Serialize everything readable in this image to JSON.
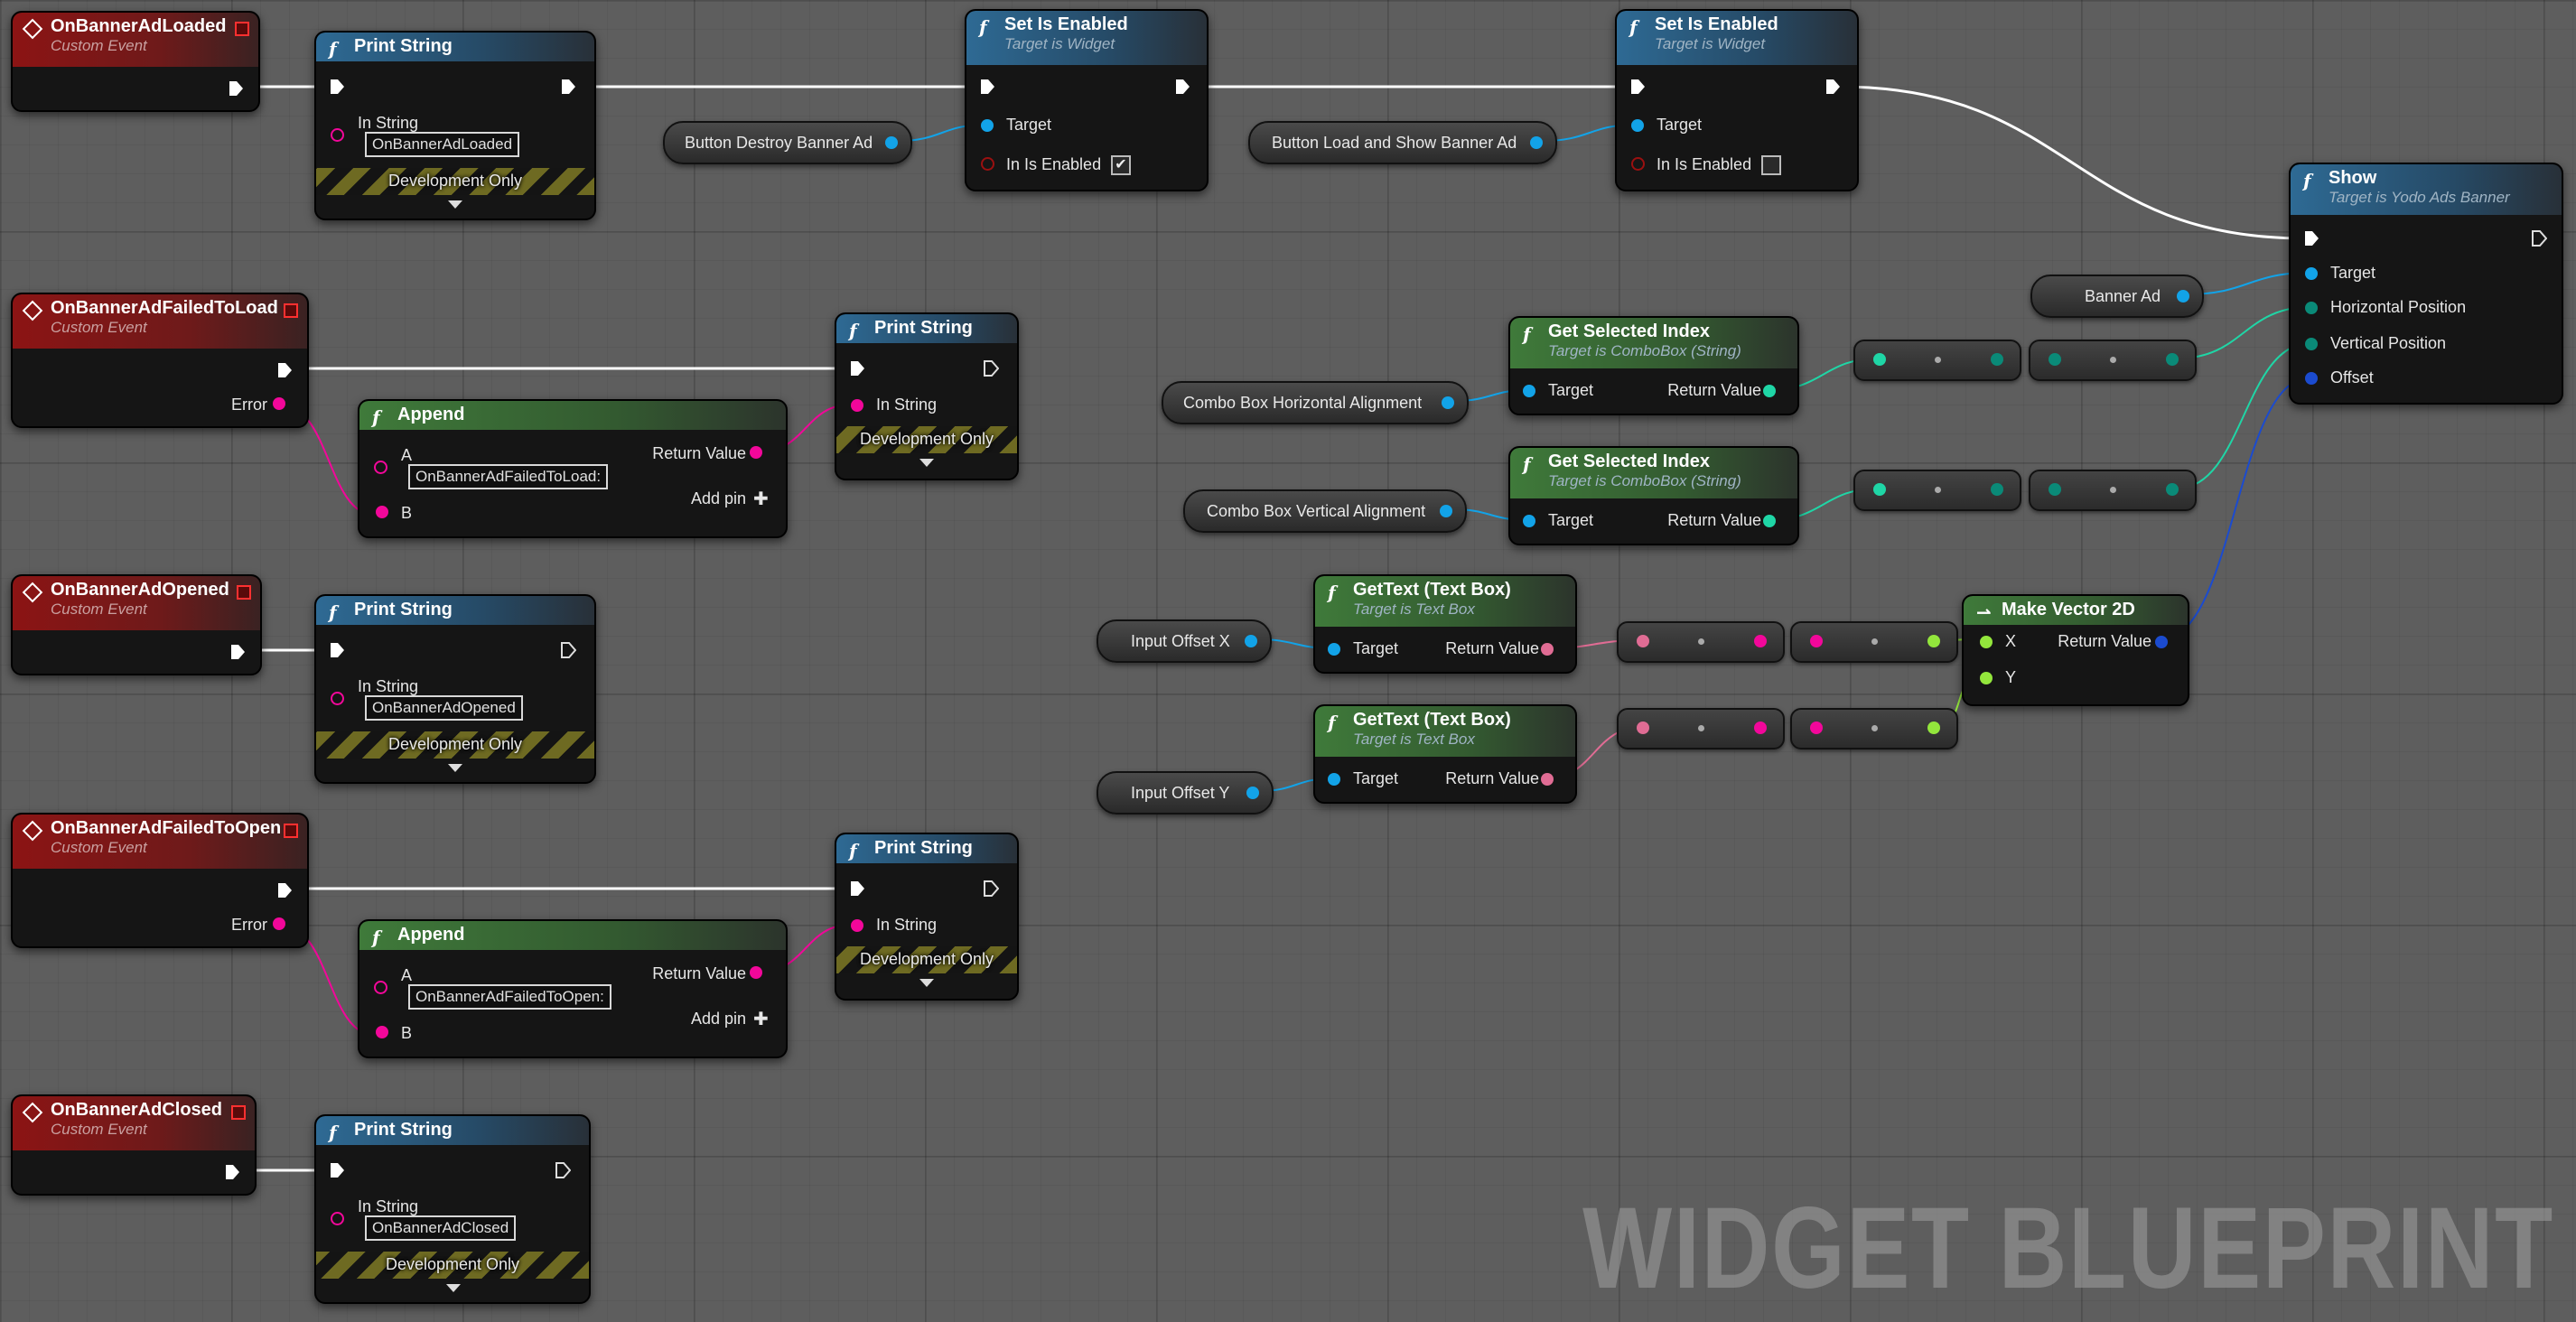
{
  "events": {
    "loaded": {
      "title": "OnBannerAdLoaded",
      "subtitle": "Custom Event"
    },
    "failed_to_load": {
      "title": "OnBannerAdFailedToLoad",
      "subtitle": "Custom Event",
      "error_label": "Error"
    },
    "opened": {
      "title": "OnBannerAdOpened",
      "subtitle": "Custom Event"
    },
    "failed_to_open": {
      "title": "OnBannerAdFailedToOpen",
      "subtitle": "Custom Event",
      "error_label": "Error"
    },
    "closed": {
      "title": "OnBannerAdClosed",
      "subtitle": "Custom Event"
    }
  },
  "print_nodes": {
    "title": "Print String",
    "in_string_label": "In String",
    "dev_only": "Development Only",
    "loaded_value": "OnBannerAdLoaded",
    "opened_value": "OnBannerAdOpened",
    "closed_value": "OnBannerAdClosed"
  },
  "append_nodes": {
    "title": "Append",
    "a_label": "A",
    "b_label": "B",
    "return_label": "Return Value",
    "add_pin": "Add pin",
    "add_icon": "✚",
    "failed_load_value": "OnBannerAdFailedToLoad:",
    "failed_open_value": "OnBannerAdFailedToOpen:"
  },
  "set_enabled": {
    "title": "Set Is Enabled",
    "subtitle": "Target is Widget",
    "target_label": "Target",
    "in_enabled_label": "In Is Enabled",
    "first_checked_mark": "✔",
    "second_checked_mark": ""
  },
  "variables": {
    "button_destroy": "Button Destroy Banner Ad",
    "button_load_show": "Button Load and Show Banner Ad",
    "banner_ad": "Banner Ad",
    "combo_horizontal": "Combo Box Horizontal Alignment",
    "combo_vertical": "Combo Box Vertical Alignment",
    "input_offset_x": "Input Offset X",
    "input_offset_y": "Input Offset Y"
  },
  "selected_index": {
    "title": "Get Selected Index",
    "subtitle": "Target is ComboBox (String)",
    "target_label": "Target",
    "return_label": "Return Value"
  },
  "get_text": {
    "title": "GetText (Text Box)",
    "subtitle": "Target is Text Box",
    "target_label": "Target",
    "return_label": "Return Value"
  },
  "make_vector": {
    "title": "Make Vector 2D",
    "x_label": "X",
    "y_label": "Y",
    "return_label": "Return Value"
  },
  "show": {
    "title": "Show",
    "subtitle": "Target is Yodo Ads Banner",
    "target_label": "Target",
    "horizontal_label": "Horizontal Position",
    "vertical_label": "Vertical Position",
    "offset_label": "Offset"
  },
  "icons": {
    "function": "f",
    "vector": "⇀"
  },
  "watermark": "WIDGET BLUEPRINT",
  "colors": {
    "exec": "#ffffff",
    "object": "#12a3e8",
    "string": "#f2079a",
    "byte": "#1fd6a6",
    "text": "#e06c94",
    "float": "#93e63c",
    "struct": "#1b4bcf"
  }
}
